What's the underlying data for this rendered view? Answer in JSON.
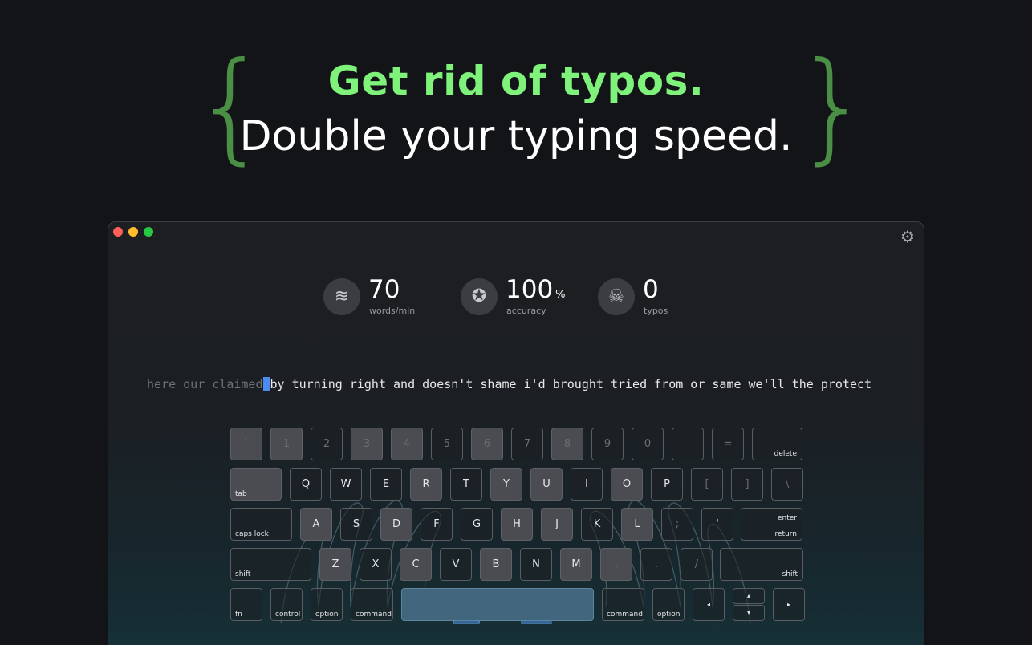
{
  "headline": {
    "line1": "Get rid of typos.",
    "line2": "Double your typing speed.",
    "brace_left": "{",
    "brace_right": "}"
  },
  "colors": {
    "accent_green": "#7ef27a",
    "brace_green": "#4a8f45",
    "cursor_blue": "#4a8cf0"
  },
  "window": {
    "settings_icon": "gear-icon",
    "settings_glyph": "⚙"
  },
  "stats": [
    {
      "icon": "wind-icon",
      "glyph": "≋",
      "value": "70",
      "unit": "",
      "label": "words/min"
    },
    {
      "icon": "award-icon",
      "glyph": "✪",
      "value": "100",
      "unit": "%",
      "label": "accuracy"
    },
    {
      "icon": "skull-icon",
      "glyph": "☠",
      "value": "0",
      "unit": "",
      "label": "typos"
    }
  ],
  "typing": {
    "typed": "here our claimed",
    "remaining": "by turning right and doesn't shame i'd brought tried from or same we'll the protect"
  },
  "keyboard": {
    "row1": [
      "`",
      "1",
      "2",
      "3",
      "4",
      "5",
      "6",
      "7",
      "8",
      "9",
      "0",
      "-",
      "=",
      "delete"
    ],
    "row2": [
      "tab",
      "Q",
      "W",
      "E",
      "R",
      "T",
      "Y",
      "U",
      "I",
      "O",
      "P",
      "[",
      "]",
      "\\"
    ],
    "row3": [
      "caps lock",
      "A",
      "S",
      "D",
      "F",
      "G",
      "H",
      "J",
      "K",
      "L",
      ";",
      "'",
      "enter",
      "return"
    ],
    "row4": [
      "shift",
      "Z",
      "X",
      "C",
      "V",
      "B",
      "N",
      "M",
      ",",
      ".",
      "/",
      "shift"
    ],
    "row5": [
      "fn",
      "control",
      "option",
      "command",
      "",
      "command",
      "option",
      "◂",
      "▴",
      "▾",
      "▸"
    ],
    "caps_dot": "•"
  }
}
